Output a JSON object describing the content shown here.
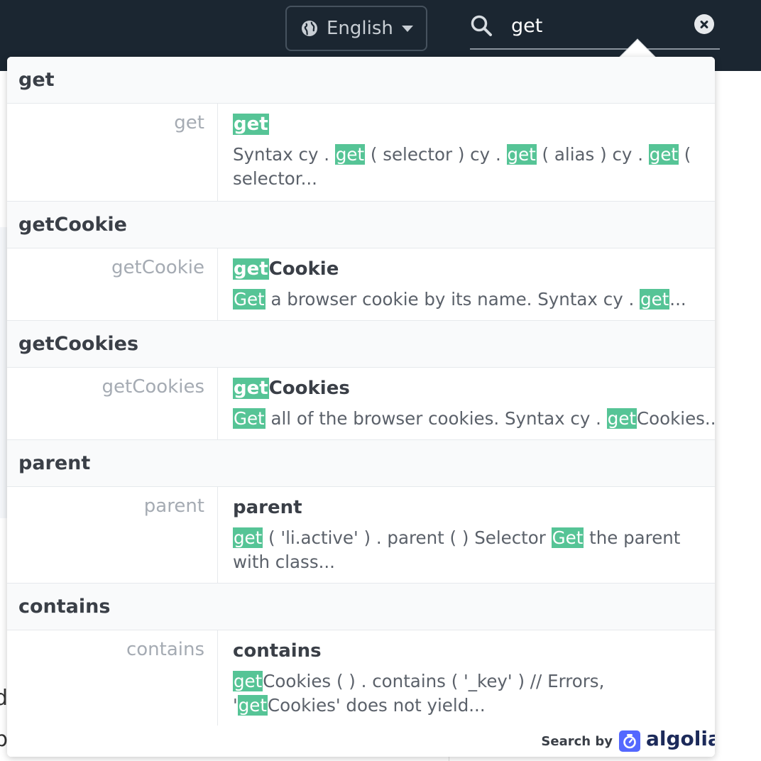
{
  "header": {
    "language_label": "English",
    "search_value": "get"
  },
  "results": [
    {
      "group": "get",
      "left": "get",
      "title": [
        {
          "t": "get",
          "h": true
        }
      ],
      "snippet_lines": [
        [
          {
            "t": "Syntax cy . "
          },
          {
            "t": "get",
            "h": true
          },
          {
            "t": " ( selector ) cy . "
          },
          {
            "t": "get",
            "h": true
          },
          {
            "t": " ( alias ) cy . "
          },
          {
            "t": "get",
            "h": true
          },
          {
            "t": " ("
          }
        ],
        [
          {
            "t": "selector..."
          }
        ]
      ]
    },
    {
      "group": "getCookie",
      "left": "getCookie",
      "title": [
        {
          "t": "get",
          "h": true
        },
        {
          "t": "Cookie"
        }
      ],
      "snippet_lines": [
        [
          {
            "t": "Get",
            "h": true
          },
          {
            "t": " a browser cookie by its name. Syntax cy . "
          },
          {
            "t": "get",
            "h": true
          },
          {
            "t": "..."
          }
        ]
      ]
    },
    {
      "group": "getCookies",
      "left": "getCookies",
      "title": [
        {
          "t": "get",
          "h": true
        },
        {
          "t": "Cookies"
        }
      ],
      "snippet_lines": [
        [
          {
            "t": "Get",
            "h": true
          },
          {
            "t": " all of the browser cookies. Syntax cy . "
          },
          {
            "t": "get",
            "h": true
          },
          {
            "t": "Cookies..."
          }
        ]
      ]
    },
    {
      "group": "parent",
      "left": "parent",
      "title": [
        {
          "t": "parent"
        }
      ],
      "snippet_lines": [
        [
          {
            "t": "get",
            "h": true
          },
          {
            "t": " ( 'li.active' ) . parent ( ) Selector "
          },
          {
            "t": "Get",
            "h": true
          },
          {
            "t": " the parent"
          }
        ],
        [
          {
            "t": "with class..."
          }
        ]
      ]
    },
    {
      "group": "contains",
      "left": "contains",
      "title": [
        {
          "t": "contains"
        }
      ],
      "snippet_lines": [
        [
          {
            "t": "get",
            "h": true
          },
          {
            "t": "Cookies ( ) . contains ( '_key' ) // Errors,"
          }
        ],
        [
          {
            "t": "'"
          },
          {
            "t": "get",
            "h": true
          },
          {
            "t": "Cookies' does not yield..."
          }
        ]
      ]
    }
  ],
  "footer": {
    "search_by": "Search by",
    "algolia": "algolia"
  },
  "background": {
    "glyph_d": "d",
    "glyph_p": "p"
  },
  "colors": {
    "topbar": "#1b2631",
    "highlight": "#56c496",
    "algolia_blue": "#5468ff"
  }
}
